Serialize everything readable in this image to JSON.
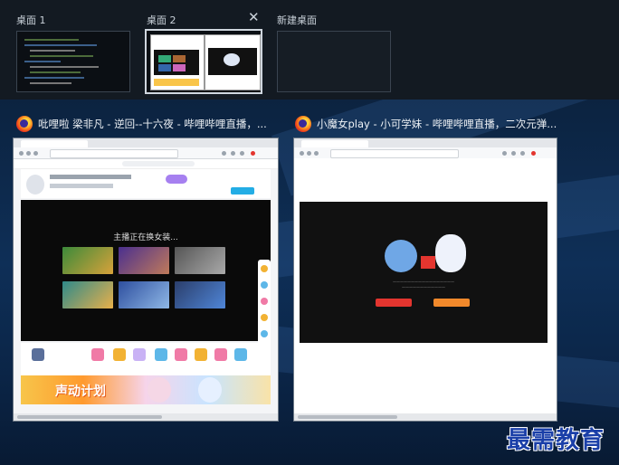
{
  "desktops": [
    {
      "label": "桌面 1"
    },
    {
      "label": "桌面 2",
      "close_icon": "close-icon"
    },
    {
      "label": "新建桌面"
    }
  ],
  "windows": [
    {
      "title": "吡哩啦 梁非凡 - 逆回--十六夜 - 哔哩哔哩直播，...",
      "player_text": "主播正在换女装...",
      "banner_text": "声动计划"
    },
    {
      "title": "小魔女play - 小可学妹 - 哔哩哔哩直播，二次元弹..."
    }
  ],
  "watermark": "最需教育"
}
